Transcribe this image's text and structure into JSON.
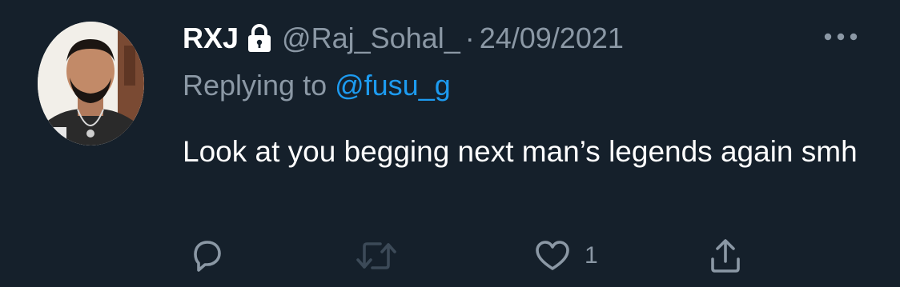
{
  "tweet": {
    "display_name": "RXJ",
    "protected": true,
    "handle": "@Raj_Sohal_",
    "separator": "·",
    "date": "24/09/2021",
    "replying_prefix": "Replying to ",
    "replying_to": "@fusu_g",
    "text": "Look at you begging next man’s legends again smh",
    "like_count": "1"
  },
  "icons": {
    "avatar": "avatar-photo",
    "lock": "lock-icon",
    "more": "more-icon",
    "reply": "reply-icon",
    "retweet": "retweet-icon",
    "like": "heart-icon",
    "share": "share-icon"
  },
  "colors": {
    "background": "#15202b",
    "primary_text": "#ffffff",
    "secondary_text": "#8b98a5",
    "accent": "#1d9bf0"
  }
}
